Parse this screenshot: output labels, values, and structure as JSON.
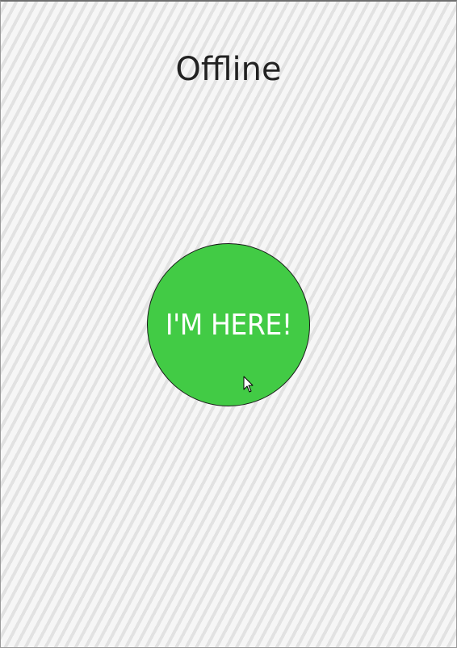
{
  "status": {
    "title": "Offline"
  },
  "checkin_button": {
    "label": "I'M HERE!",
    "color": "#42cb45"
  },
  "colors": {
    "background_stripe_light": "#f6f6f6",
    "background_stripe_dark": "#e2e2e2",
    "title_text": "#222222",
    "button_text": "#ffffff"
  },
  "icons": {
    "cursor": "mouse-pointer-icon"
  }
}
